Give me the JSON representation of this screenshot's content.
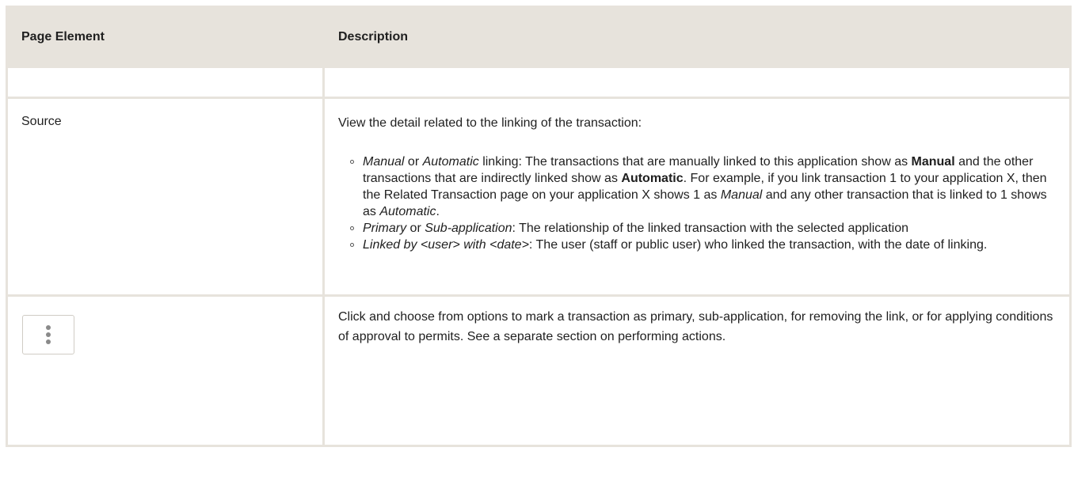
{
  "table": {
    "headers": {
      "page_element": "Page Element",
      "description": "Description"
    },
    "source_row": {
      "element": "Source",
      "intro": "View the detail related to the linking of the transaction:",
      "bullets": [
        {
          "parts": [
            {
              "t": "Manual",
              "s": "i"
            },
            {
              "t": " or ",
              "s": ""
            },
            {
              "t": "Automatic",
              "s": "i"
            },
            {
              "t": " linking: The transactions that are manually linked to this application show as ",
              "s": ""
            },
            {
              "t": "Manual",
              "s": "b"
            },
            {
              "t": " and the other transactions that are indirectly linked show as ",
              "s": ""
            },
            {
              "t": "Automatic",
              "s": "b"
            },
            {
              "t": ". For example, if you link transaction 1 to your application X, then the Related Transaction page on your application X shows 1 as ",
              "s": ""
            },
            {
              "t": "Manual",
              "s": "i"
            },
            {
              "t": " and any other transaction that is linked to 1 shows as ",
              "s": ""
            },
            {
              "t": "Automatic",
              "s": "i"
            },
            {
              "t": ".",
              "s": ""
            }
          ]
        },
        {
          "parts": [
            {
              "t": "Primary",
              "s": "i"
            },
            {
              "t": " or ",
              "s": ""
            },
            {
              "t": "Sub-application",
              "s": "i"
            },
            {
              "t": ": The relationship of the linked transaction with the selected application",
              "s": ""
            }
          ]
        },
        {
          "parts": [
            {
              "t": "Linked by <user> with <date>",
              "s": "i"
            },
            {
              "t": ": The user (staff or public user) who linked the transaction,  with the date of linking.",
              "s": ""
            }
          ]
        }
      ]
    },
    "action_row": {
      "icon": "kebab-menu-icon",
      "description": "Click and choose from options to mark a transaction as primary, sub-application, for removing the link, or for applying conditions of approval to permits. See a separate section on performing actions."
    }
  },
  "colors": {
    "header_background": "#e7e3dc",
    "border": "#e7e3dc",
    "text": "#1f1f1f"
  }
}
